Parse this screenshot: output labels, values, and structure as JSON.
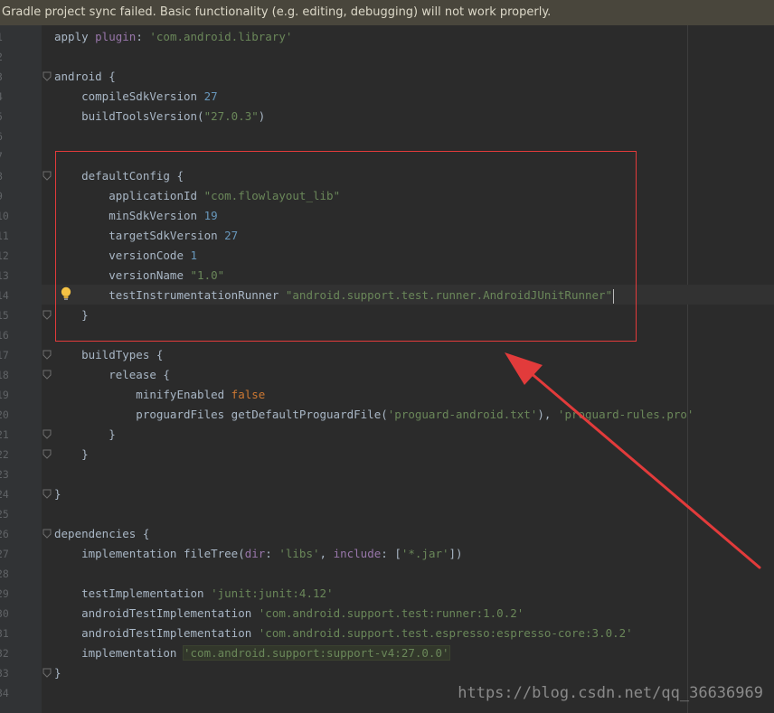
{
  "banner": {
    "text": "Gradle project sync failed. Basic functionality (e.g. editing, debugging) will not work properly."
  },
  "editor": {
    "lines": [
      {
        "n": "1",
        "fold": false,
        "tokens": [
          [
            "p",
            "apply "
          ],
          [
            "arg",
            "plugin"
          ],
          [
            "p",
            ": "
          ],
          [
            "str",
            "'com.android.library'"
          ]
        ]
      },
      {
        "n": "2",
        "fold": false,
        "tokens": []
      },
      {
        "n": "3",
        "fold": true,
        "tokens": [
          [
            "p",
            "android {"
          ]
        ]
      },
      {
        "n": "4",
        "fold": false,
        "tokens": [
          [
            "p",
            "    compileSdkVersion "
          ],
          [
            "num",
            "27"
          ]
        ]
      },
      {
        "n": "5",
        "fold": false,
        "tokens": [
          [
            "p",
            "    buildToolsVersion("
          ],
          [
            "str",
            "\"27.0.3\""
          ],
          [
            "p",
            ")"
          ]
        ]
      },
      {
        "n": "6",
        "fold": false,
        "tokens": []
      },
      {
        "n": "7",
        "fold": false,
        "tokens": []
      },
      {
        "n": "8",
        "fold": true,
        "tokens": [
          [
            "p",
            "    defaultConfig {"
          ]
        ]
      },
      {
        "n": "9",
        "fold": false,
        "tokens": [
          [
            "p",
            "        applicationId "
          ],
          [
            "str",
            "\"com.flowlayout_lib\""
          ]
        ]
      },
      {
        "n": "10",
        "fold": false,
        "tokens": [
          [
            "p",
            "        minSdkVersion "
          ],
          [
            "num",
            "19"
          ]
        ]
      },
      {
        "n": "11",
        "fold": false,
        "tokens": [
          [
            "p",
            "        targetSdkVersion "
          ],
          [
            "num",
            "27"
          ]
        ]
      },
      {
        "n": "12",
        "fold": false,
        "tokens": [
          [
            "p",
            "        versionCode "
          ],
          [
            "num",
            "1"
          ]
        ]
      },
      {
        "n": "13",
        "fold": false,
        "tokens": [
          [
            "p",
            "        versionName "
          ],
          [
            "str",
            "\"1.0\""
          ]
        ]
      },
      {
        "n": "14",
        "fold": false,
        "tokens": [
          [
            "p",
            "        testInstrumentationRunner "
          ],
          [
            "str",
            "\"android.support.test.runner.AndroidJUnitRunner\""
          ]
        ],
        "caret": true,
        "bulb": true
      },
      {
        "n": "15",
        "fold": true,
        "tokens": [
          [
            "p",
            "    }"
          ]
        ]
      },
      {
        "n": "16",
        "fold": false,
        "tokens": []
      },
      {
        "n": "17",
        "fold": true,
        "tokens": [
          [
            "p",
            "    buildTypes {"
          ]
        ]
      },
      {
        "n": "18",
        "fold": true,
        "tokens": [
          [
            "p",
            "        release {"
          ]
        ]
      },
      {
        "n": "19",
        "fold": false,
        "tokens": [
          [
            "p",
            "            minifyEnabled "
          ],
          [
            "key",
            "false"
          ]
        ]
      },
      {
        "n": "20",
        "fold": false,
        "tokens": [
          [
            "p",
            "            proguardFiles getDefaultProguardFile("
          ],
          [
            "str",
            "'proguard-android.txt'"
          ],
          [
            "p",
            "), "
          ],
          [
            "str",
            "'proguard-rules.pro'"
          ]
        ]
      },
      {
        "n": "21",
        "fold": true,
        "tokens": [
          [
            "p",
            "        }"
          ]
        ]
      },
      {
        "n": "22",
        "fold": true,
        "tokens": [
          [
            "p",
            "    }"
          ]
        ]
      },
      {
        "n": "23",
        "fold": false,
        "tokens": []
      },
      {
        "n": "24",
        "fold": true,
        "tokens": [
          [
            "p",
            "}"
          ]
        ]
      },
      {
        "n": "25",
        "fold": false,
        "tokens": []
      },
      {
        "n": "26",
        "fold": true,
        "tokens": [
          [
            "p",
            "dependencies {"
          ]
        ]
      },
      {
        "n": "27",
        "fold": false,
        "tokens": [
          [
            "p",
            "    implementation fileTree("
          ],
          [
            "arg",
            "dir"
          ],
          [
            "p",
            ": "
          ],
          [
            "str",
            "'libs'"
          ],
          [
            "p",
            ", "
          ],
          [
            "arg",
            "include"
          ],
          [
            "p",
            ": ["
          ],
          [
            "str",
            "'*.jar'"
          ],
          [
            "p",
            "])"
          ]
        ]
      },
      {
        "n": "28",
        "fold": false,
        "tokens": []
      },
      {
        "n": "29",
        "fold": false,
        "tokens": [
          [
            "p",
            "    testImplementation "
          ],
          [
            "str",
            "'junit:junit:4.12'"
          ]
        ]
      },
      {
        "n": "30",
        "fold": false,
        "tokens": [
          [
            "p",
            "    androidTestImplementation "
          ],
          [
            "str",
            "'com.android.support.test:runner:1.0.2'"
          ]
        ]
      },
      {
        "n": "31",
        "fold": false,
        "tokens": [
          [
            "p",
            "    androidTestImplementation "
          ],
          [
            "str",
            "'com.android.support.test.espresso:espresso-core:3.0.2'"
          ]
        ]
      },
      {
        "n": "32",
        "fold": false,
        "tokens": [
          [
            "p",
            "    implementation "
          ],
          [
            "hl",
            "'com.android.support:support-v4:27.0.0'"
          ]
        ]
      },
      {
        "n": "33",
        "fold": true,
        "tokens": [
          [
            "p",
            "}"
          ]
        ]
      },
      {
        "n": "34",
        "fold": false,
        "tokens": []
      }
    ]
  },
  "watermark": {
    "text": "https://blog.csdn.net/qq_36636969"
  },
  "colors": {
    "annotation": "#e23b3b",
    "string": "#6a8759",
    "number": "#6897bb",
    "keyword": "#cc7832"
  }
}
